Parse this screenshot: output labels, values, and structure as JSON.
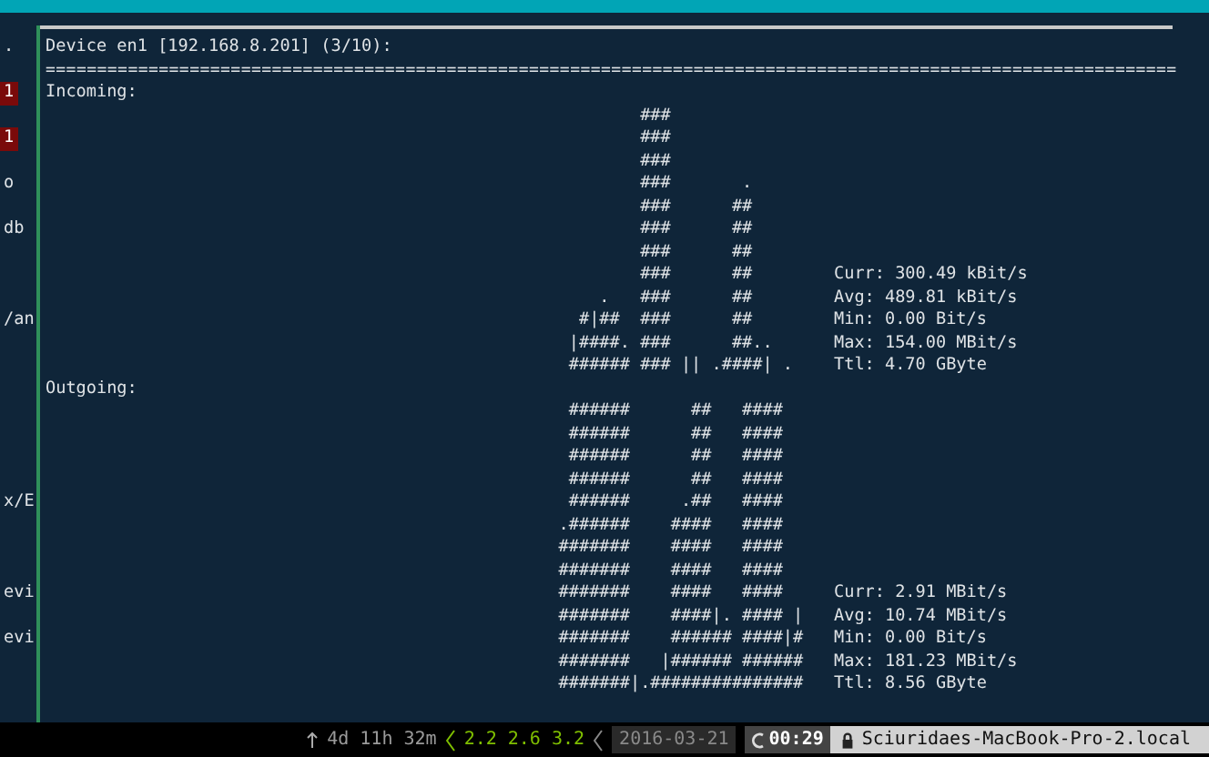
{
  "side_pane": {
    "lines": [
      {
        "text": ".",
        "highlighted": false
      },
      {
        "text": "1",
        "highlighted": true
      },
      {
        "text": "1",
        "highlighted": true
      },
      {
        "text": "o",
        "highlighted": false
      },
      {
        "text": "db",
        "highlighted": false
      },
      {
        "text": "/an",
        "highlighted": false
      },
      {
        "text": "x/E",
        "highlighted": false
      },
      {
        "text": "evi",
        "highlighted": false
      },
      {
        "text": "evi",
        "highlighted": false
      }
    ]
  },
  "device": {
    "title": "Device en1 [192.168.8.201] (3/10):",
    "rule": "=============================================================================================================="
  },
  "incoming": {
    "label": "Incoming:",
    "graph": [
      "           ###",
      "           ###",
      "           ###",
      "           ###       .",
      "           ###      ##",
      "           ###      ##",
      "           ###      ##",
      "           ###      ##",
      "       .   ###      ##",
      "     #|##  ###      ##",
      "    |####. ###      ##..",
      "    ###### ### || .####| ."
    ],
    "stats": [
      "Curr: 300.49 kBit/s",
      "Avg: 489.81 kBit/s",
      "Min: 0.00 Bit/s",
      "Max: 154.00 MBit/s",
      "Ttl: 4.70 GByte"
    ]
  },
  "outgoing": {
    "label": "Outgoing:",
    "graph": [
      "    ######      ##   ####",
      "    ######      ##   ####",
      "    ######      ##   ####",
      "    ######      ##   ####",
      "    ######     .##   ####",
      "   .######    ####   ####",
      "   #######    ####   ####",
      "   #######    ####   ####",
      "   #######    ####   ####",
      "   #######    ####|. #### |",
      "   #######    ###### ####|#",
      "   #######   |###### ######",
      "   #######|.###############"
    ],
    "stats": [
      "Curr: 2.91 MBit/s",
      "Avg: 10.74 MBit/s",
      "Min: 0.00 Bit/s",
      "Max: 181.23 MBit/s",
      "Ttl: 8.56 GByte"
    ]
  },
  "status_bar": {
    "uptime": "4d 11h 32m",
    "load": "2.2 2.6 3.2",
    "date": "2016-03-21",
    "time": "00:29",
    "host": "Sciuridaes-MacBook-Pro-2.local"
  }
}
